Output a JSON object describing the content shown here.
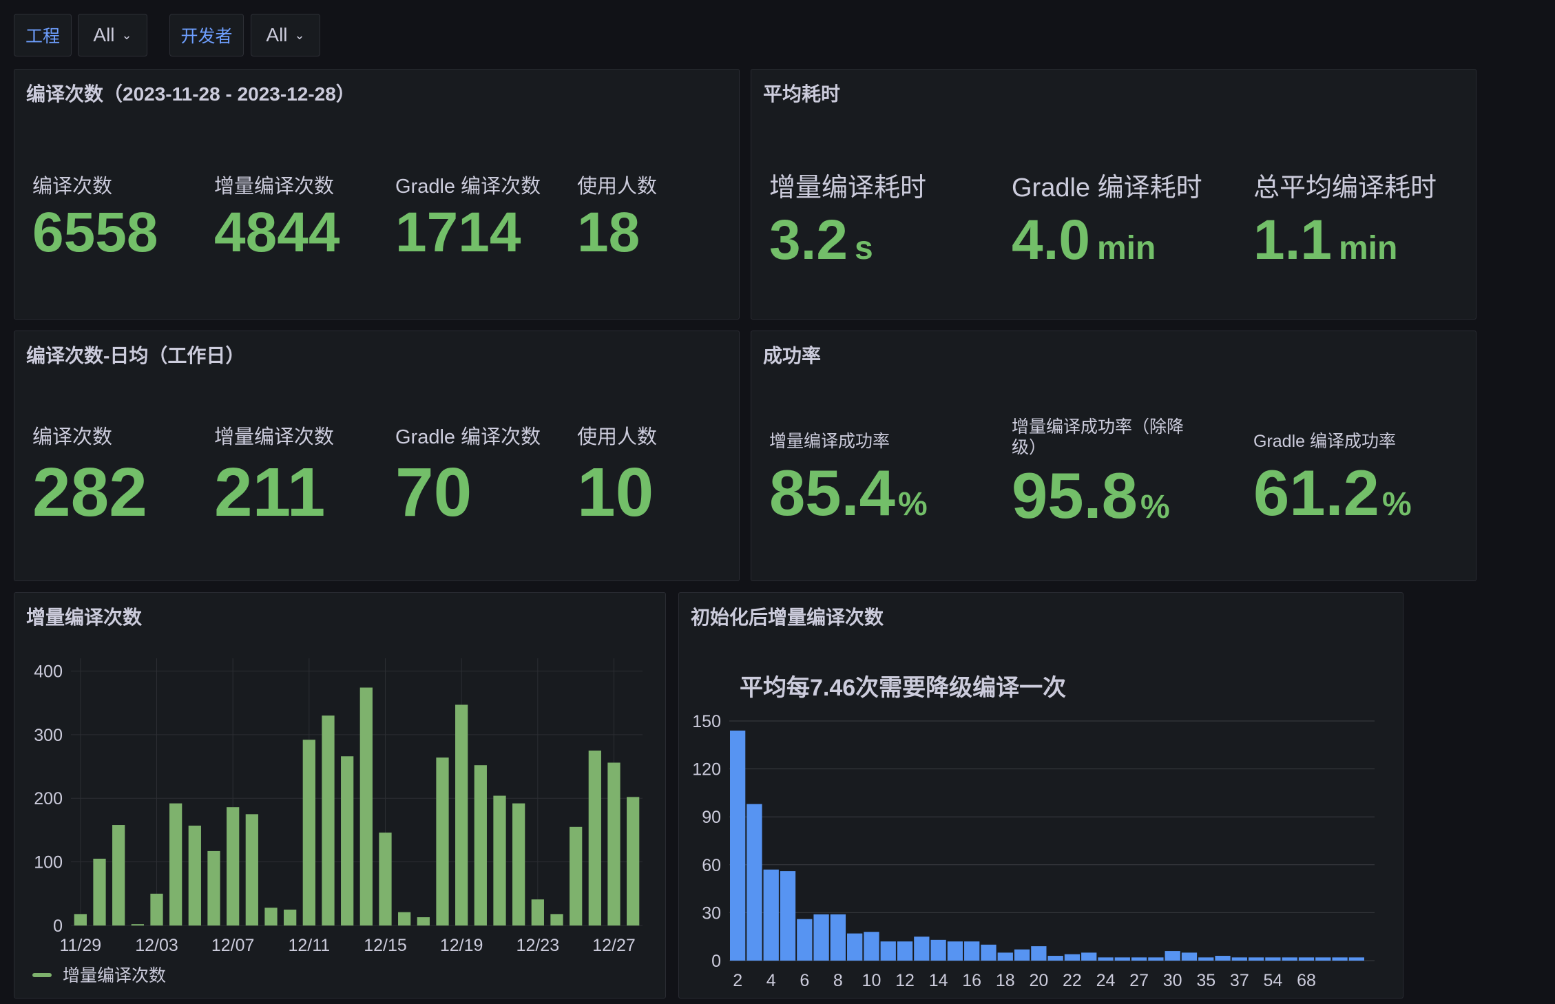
{
  "filters": [
    {
      "label": "工程",
      "value": "All"
    },
    {
      "label": "开发者",
      "value": "All"
    }
  ],
  "panels": {
    "build_count": {
      "title": "编译次数（2023-11-28 - 2023-12-28）",
      "stats": [
        {
          "label": "编译次数",
          "value": "6558"
        },
        {
          "label": "增量编译次数",
          "value": "4844"
        },
        {
          "label": "Gradle 编译次数",
          "value": "1714"
        },
        {
          "label": "使用人数",
          "value": "18"
        }
      ]
    },
    "avg_time": {
      "title": "平均耗时",
      "stats": [
        {
          "label": "增量编译耗时",
          "value": "3.2",
          "unit": "s"
        },
        {
          "label": "Gradle 编译耗时",
          "value": "4.0",
          "unit": "min"
        },
        {
          "label": "总平均编译耗时",
          "value": "1.1",
          "unit": "min"
        }
      ]
    },
    "daily_avg": {
      "title": "编译次数-日均（工作日）",
      "stats": [
        {
          "label": "编译次数",
          "value": "282"
        },
        {
          "label": "增量编译次数",
          "value": "211"
        },
        {
          "label": "Gradle 编译次数",
          "value": "70"
        },
        {
          "label": "使用人数",
          "value": "10"
        }
      ]
    },
    "success_rate": {
      "title": "成功率",
      "stats": [
        {
          "label": "增量编译成功率",
          "value": "85.4",
          "unit": "%"
        },
        {
          "label": "增量编译成功率（除降级）",
          "value": "95.8",
          "unit": "%"
        },
        {
          "label": "Gradle 编译成功率",
          "value": "61.2",
          "unit": "%"
        }
      ]
    },
    "incremental_chart": {
      "title": "增量编译次数",
      "legend": "增量编译次数"
    },
    "post_init_chart": {
      "title": "初始化后增量编译次数"
    }
  },
  "colors": {
    "stat_green": "#73bf69",
    "bar_green": "#7eb26d",
    "bar_blue": "#5794f2"
  },
  "chart_data": [
    {
      "type": "bar",
      "title": "增量编译次数",
      "legend": "增量编译次数",
      "x_ticks": [
        "11/29",
        "12/03",
        "12/07",
        "12/11",
        "12/15",
        "12/19",
        "12/23",
        "12/27"
      ],
      "y_ticks": [
        0,
        100,
        200,
        300,
        400
      ],
      "ylim": [
        0,
        420
      ],
      "x": [
        "11/29",
        "11/30",
        "12/01",
        "12/02",
        "12/03",
        "12/04",
        "12/05",
        "12/06",
        "12/07",
        "12/08",
        "12/09",
        "12/10",
        "12/11",
        "12/12",
        "12/13",
        "12/14",
        "12/15",
        "12/16",
        "12/17",
        "12/18",
        "12/19",
        "12/20",
        "12/21",
        "12/22",
        "12/23",
        "12/24",
        "12/25",
        "12/26",
        "12/27",
        "12/28"
      ],
      "series": [
        {
          "name": "增量编译次数",
          "color": "#7eb26d",
          "values": [
            18,
            105,
            158,
            2,
            50,
            192,
            157,
            117,
            186,
            175,
            28,
            25,
            292,
            330,
            266,
            374,
            146,
            21,
            13,
            264,
            347,
            252,
            204,
            192,
            41,
            18,
            155,
            275,
            256,
            202
          ]
        }
      ],
      "grid": true,
      "legend_position": "bottom-left"
    },
    {
      "type": "bar",
      "title": "平均每7.46次需要降级编译一次",
      "x_ticks": [
        "2",
        "4",
        "6",
        "8",
        "10",
        "12",
        "14",
        "16",
        "18",
        "20",
        "22",
        "24",
        "27",
        "30",
        "35",
        "37",
        "54",
        "68"
      ],
      "y_ticks": [
        0,
        30,
        60,
        90,
        120,
        150
      ],
      "ylim": [
        0,
        150
      ],
      "series": [
        {
          "color": "#5794f2",
          "values": [
            144,
            98,
            57,
            56,
            26,
            29,
            29,
            17,
            18,
            12,
            12,
            15,
            13,
            12,
            12,
            10,
            5,
            7,
            9,
            3,
            4,
            5,
            2,
            2,
            2,
            2,
            6,
            5,
            2,
            3,
            2,
            2,
            2,
            2,
            2,
            2,
            2,
            2
          ]
        }
      ],
      "grid": true
    }
  ]
}
